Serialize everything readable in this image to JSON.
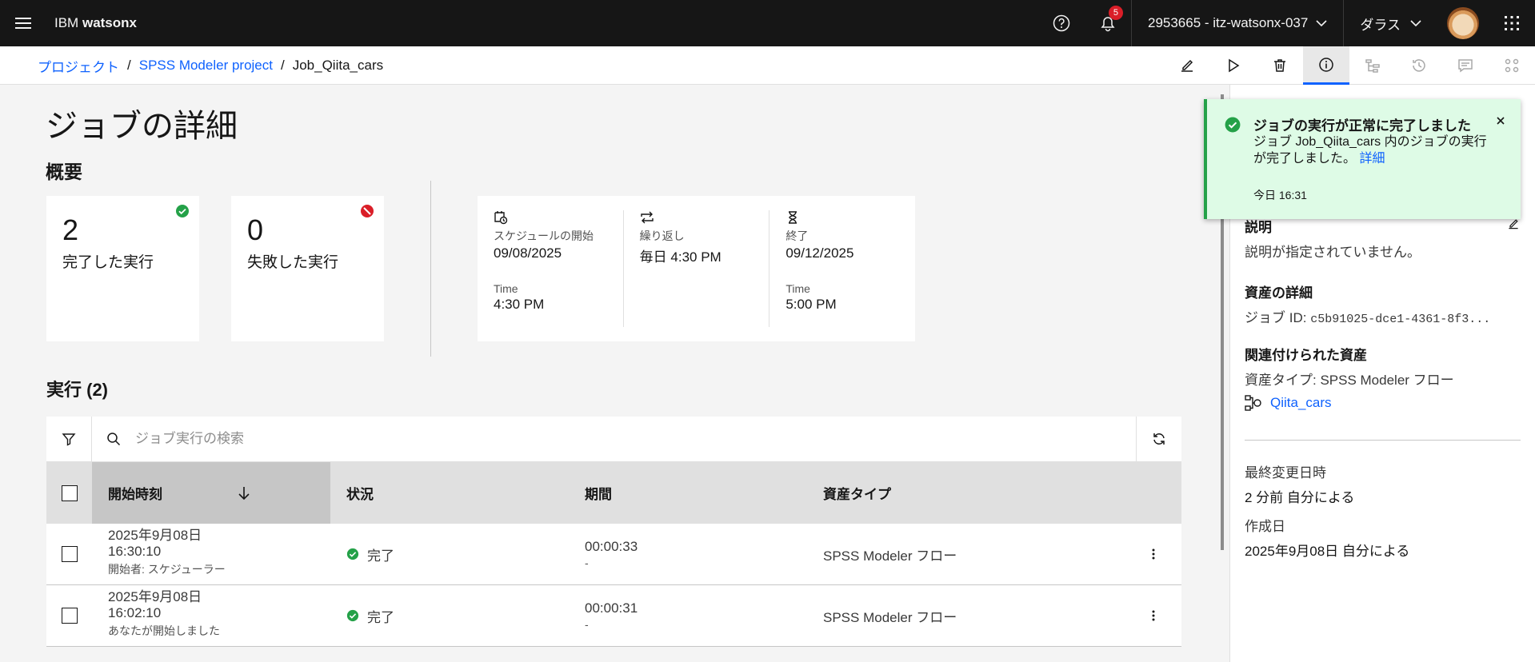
{
  "header": {
    "brand_prefix": "IBM",
    "brand_name": "watsonx",
    "notification_count": "5",
    "account": "2953665 - itz-watsonx-037",
    "region": "ダラス"
  },
  "breadcrumb": {
    "items": [
      "プロジェクト",
      "SPSS Modeler project",
      "Job_Qiita_cars"
    ],
    "separator": "/"
  },
  "page": {
    "title": "ジョブの詳細",
    "overview_title": "概要"
  },
  "stats": {
    "completed_count": "2",
    "completed_label": "完了した実行",
    "failed_count": "0",
    "failed_label": "失敗した実行"
  },
  "schedule": {
    "start_label": "スケジュールの開始",
    "start_date": "09/08/2025",
    "start_time_label": "Time",
    "start_time": "4:30 PM",
    "repeat_label": "繰り返し",
    "repeat_value": "毎日 4:30 PM",
    "end_label": "終了",
    "end_date": "09/12/2025",
    "end_time_label": "Time",
    "end_time": "5:00 PM"
  },
  "runs": {
    "title": "実行 (2)",
    "search_placeholder": "ジョブ実行の検索",
    "columns": [
      "開始時刻",
      "状況",
      "期間",
      "資産タイプ"
    ],
    "rows": [
      {
        "start": "2025年9月08日 16:30:10",
        "started_by": "開始者: スケジューラー",
        "status": "完了",
        "duration": "00:00:33",
        "duration_sub": "-",
        "asset_type": "SPSS Modeler フロー"
      },
      {
        "start": "2025年9月08日 16:02:10",
        "started_by": "あなたが開始しました",
        "status": "完了",
        "duration": "00:00:31",
        "duration_sub": "-",
        "asset_type": "SPSS Modeler フロー"
      }
    ]
  },
  "side_panel": {
    "description_title": "説明",
    "description_text": "説明が指定されていません。",
    "asset_details_title": "資産の詳細",
    "job_id_label": "ジョブ ID:",
    "job_id_value": "c5b91025-dce1-4361-8f3...",
    "related_title": "関連付けられた資産",
    "asset_type_text": "資産タイプ: SPSS Modeler フロー",
    "asset_link": "Qiita_cars",
    "last_modified_title": "最終変更日時",
    "last_modified_value": "2 分前 自分による",
    "created_title": "作成日",
    "created_value": "2025年9月08日 自分による"
  },
  "toast": {
    "title": "ジョブの実行が正常に完了しました",
    "body": "ジョブ Job_Qiita_cars 内のジョブの実行が完了しました。",
    "link": "詳細",
    "time": "今日 16:31"
  },
  "colors": {
    "link": "#0f62fe",
    "success": "#24a148",
    "error": "#da1e28",
    "topbar": "#161616"
  }
}
